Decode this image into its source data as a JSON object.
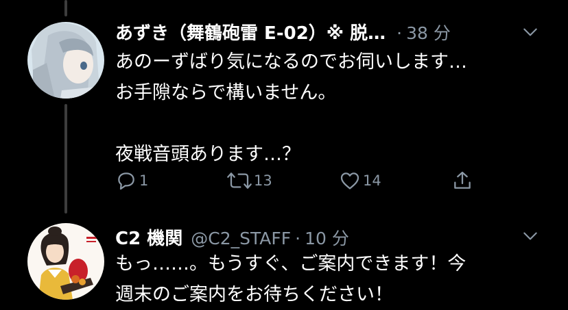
{
  "tweets": [
    {
      "name": "あずき（舞鶴砲雷 E-02）※ 脱…",
      "handle": "",
      "time": "38 分",
      "body": "あのーずばり気になるのでお伺いします…\nお手隙ならで構いません。\n\n夜戦音頭あります…？",
      "reply_count": "1",
      "retweet_count": "13",
      "like_count": "14"
    },
    {
      "name": "C2 機関",
      "handle": "@C2_STAFF",
      "time": "10 分",
      "body": "もっ……。もうすぐ、ご案内できます！今\n週末のご案内をお待ちください！"
    }
  ],
  "separator": "·",
  "icons": [
    "chevron-down-icon",
    "reply-icon",
    "retweet-icon",
    "like-icon",
    "share-icon"
  ],
  "colors": {
    "background": "#000000",
    "text": "#ffffff",
    "secondary": "#8b98a5",
    "thread_line": "#3d3d3d"
  }
}
